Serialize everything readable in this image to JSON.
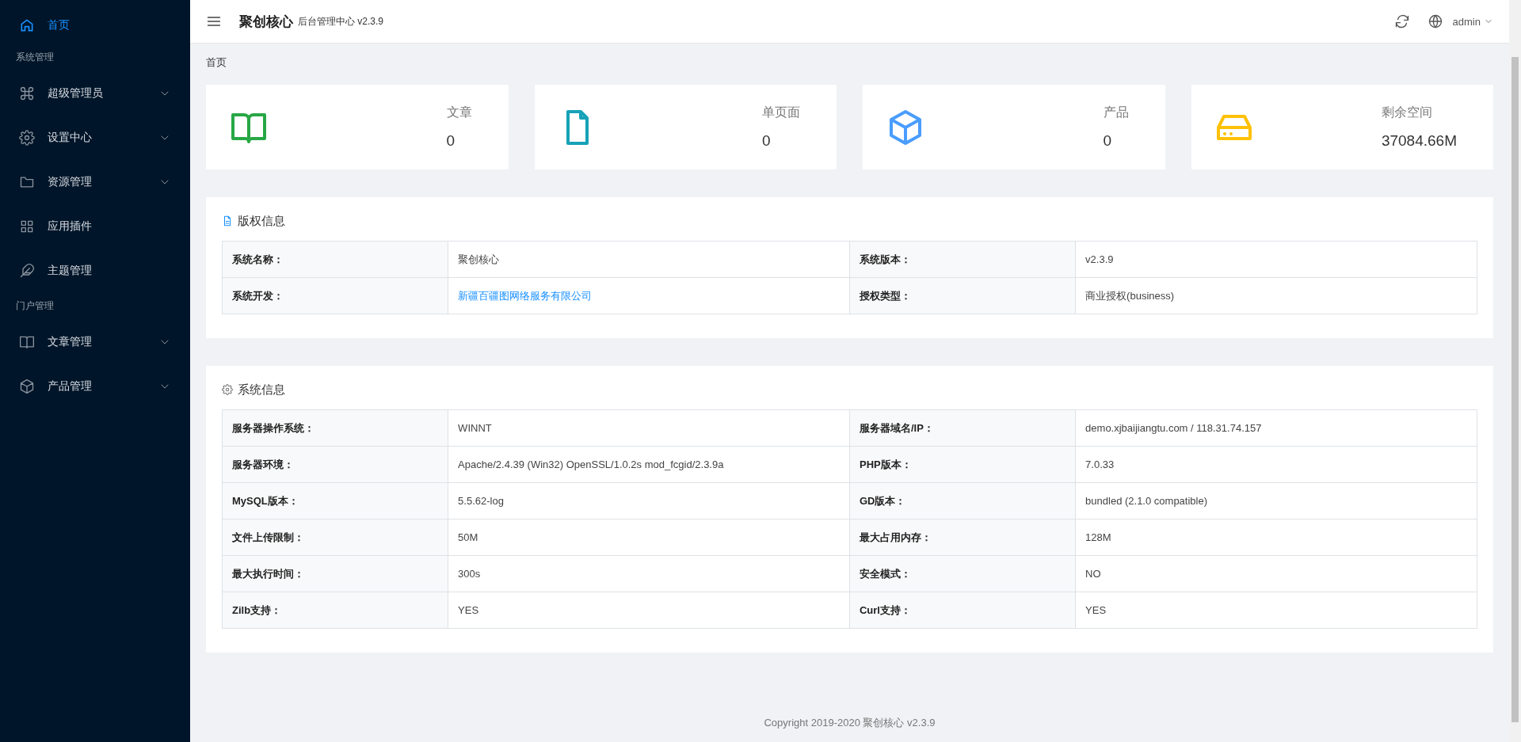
{
  "header": {
    "title": "聚创核心",
    "subtitle": "后台管理中心 v2.3.9",
    "user": "admin"
  },
  "sidebar": {
    "items": [
      {
        "kind": "link",
        "label": "首页",
        "selected": true,
        "expandable": false
      },
      {
        "kind": "section",
        "label": "系统管理"
      },
      {
        "kind": "link",
        "label": "超级管理员",
        "selected": false,
        "expandable": true
      },
      {
        "kind": "link",
        "label": "设置中心",
        "selected": false,
        "expandable": true
      },
      {
        "kind": "link",
        "label": "资源管理",
        "selected": false,
        "expandable": true
      },
      {
        "kind": "link",
        "label": "应用插件",
        "selected": false,
        "expandable": false
      },
      {
        "kind": "link",
        "label": "主题管理",
        "selected": false,
        "expandable": false
      },
      {
        "kind": "section",
        "label": "门户管理"
      },
      {
        "kind": "link",
        "label": "文章管理",
        "selected": false,
        "expandable": true
      },
      {
        "kind": "link",
        "label": "产品管理",
        "selected": false,
        "expandable": true
      }
    ]
  },
  "breadcrumb": "首页",
  "stats": [
    {
      "label": "文章",
      "value": "0",
      "color": "#28a745"
    },
    {
      "label": "单页面",
      "value": "0",
      "color": "#17a2b8"
    },
    {
      "label": "产品",
      "value": "0",
      "color": "#4a9dff"
    },
    {
      "label": "剩余空间",
      "value": "37084.66M",
      "color": "#ffc107"
    }
  ],
  "panels": [
    {
      "title": "版权信息",
      "rows": [
        [
          {
            "label": "系统名称：",
            "value": "聚创核心",
            "kind": "text"
          },
          {
            "label": "系统版本：",
            "value": "v2.3.9",
            "kind": "text"
          }
        ],
        [
          {
            "label": "系统开发：",
            "value": "新疆百疆图网络服务有限公司",
            "kind": "link"
          },
          {
            "label": "授权类型：",
            "value": "商业授权(business)",
            "kind": "text"
          }
        ]
      ]
    },
    {
      "title": "系统信息",
      "rows": [
        [
          {
            "label": "服务器操作系统：",
            "value": "WINNT",
            "kind": "text"
          },
          {
            "label": "服务器域名/IP：",
            "value": "demo.xjbaijiangtu.com / 118.31.74.157",
            "kind": "text"
          }
        ],
        [
          {
            "label": "服务器环境：",
            "value": "Apache/2.4.39 (Win32) OpenSSL/1.0.2s mod_fcgid/2.3.9a",
            "kind": "text"
          },
          {
            "label": "PHP版本：",
            "value": "7.0.33",
            "kind": "text"
          }
        ],
        [
          {
            "label": "MySQL版本：",
            "value": "5.5.62-log",
            "kind": "text"
          },
          {
            "label": "GD版本：",
            "value": "bundled (2.1.0 compatible)",
            "kind": "text"
          }
        ],
        [
          {
            "label": "文件上传限制：",
            "value": "50M",
            "kind": "text"
          },
          {
            "label": "最大占用内存：",
            "value": "128M",
            "kind": "text"
          }
        ],
        [
          {
            "label": "最大执行时间：",
            "value": "300s",
            "kind": "text"
          },
          {
            "label": "安全模式：",
            "value": "NO",
            "kind": "text"
          }
        ],
        [
          {
            "label": "Zilb支持：",
            "value": "YES",
            "kind": "text"
          },
          {
            "label": "Curl支持：",
            "value": "YES",
            "kind": "text"
          }
        ]
      ]
    }
  ],
  "footer": "Copyright 2019-2020 聚创核心 v2.3.9"
}
